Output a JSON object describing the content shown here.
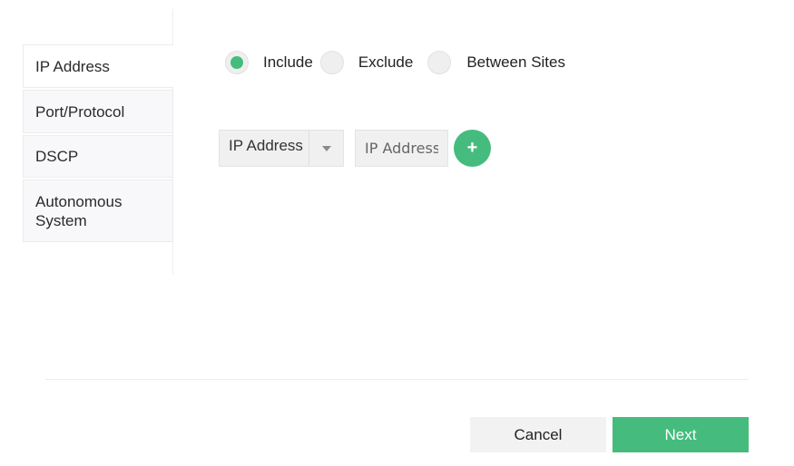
{
  "sidebar": {
    "items": [
      {
        "label": "IP Address",
        "active": true
      },
      {
        "label": "Port/Protocol",
        "active": false
      },
      {
        "label": "DSCP",
        "active": false
      },
      {
        "label": "Autonomous System",
        "active": false
      }
    ]
  },
  "scope": {
    "options": [
      {
        "label": "Include",
        "selected": true
      },
      {
        "label": "Exclude",
        "selected": false
      },
      {
        "label": "Between Sites",
        "selected": false
      }
    ]
  },
  "filter": {
    "type_selected": "IP Address",
    "value_placeholder": "IP Address",
    "add_icon": "plus-icon"
  },
  "footer": {
    "cancel_label": "Cancel",
    "next_label": "Next"
  },
  "colors": {
    "accent": "#45bc7d"
  }
}
